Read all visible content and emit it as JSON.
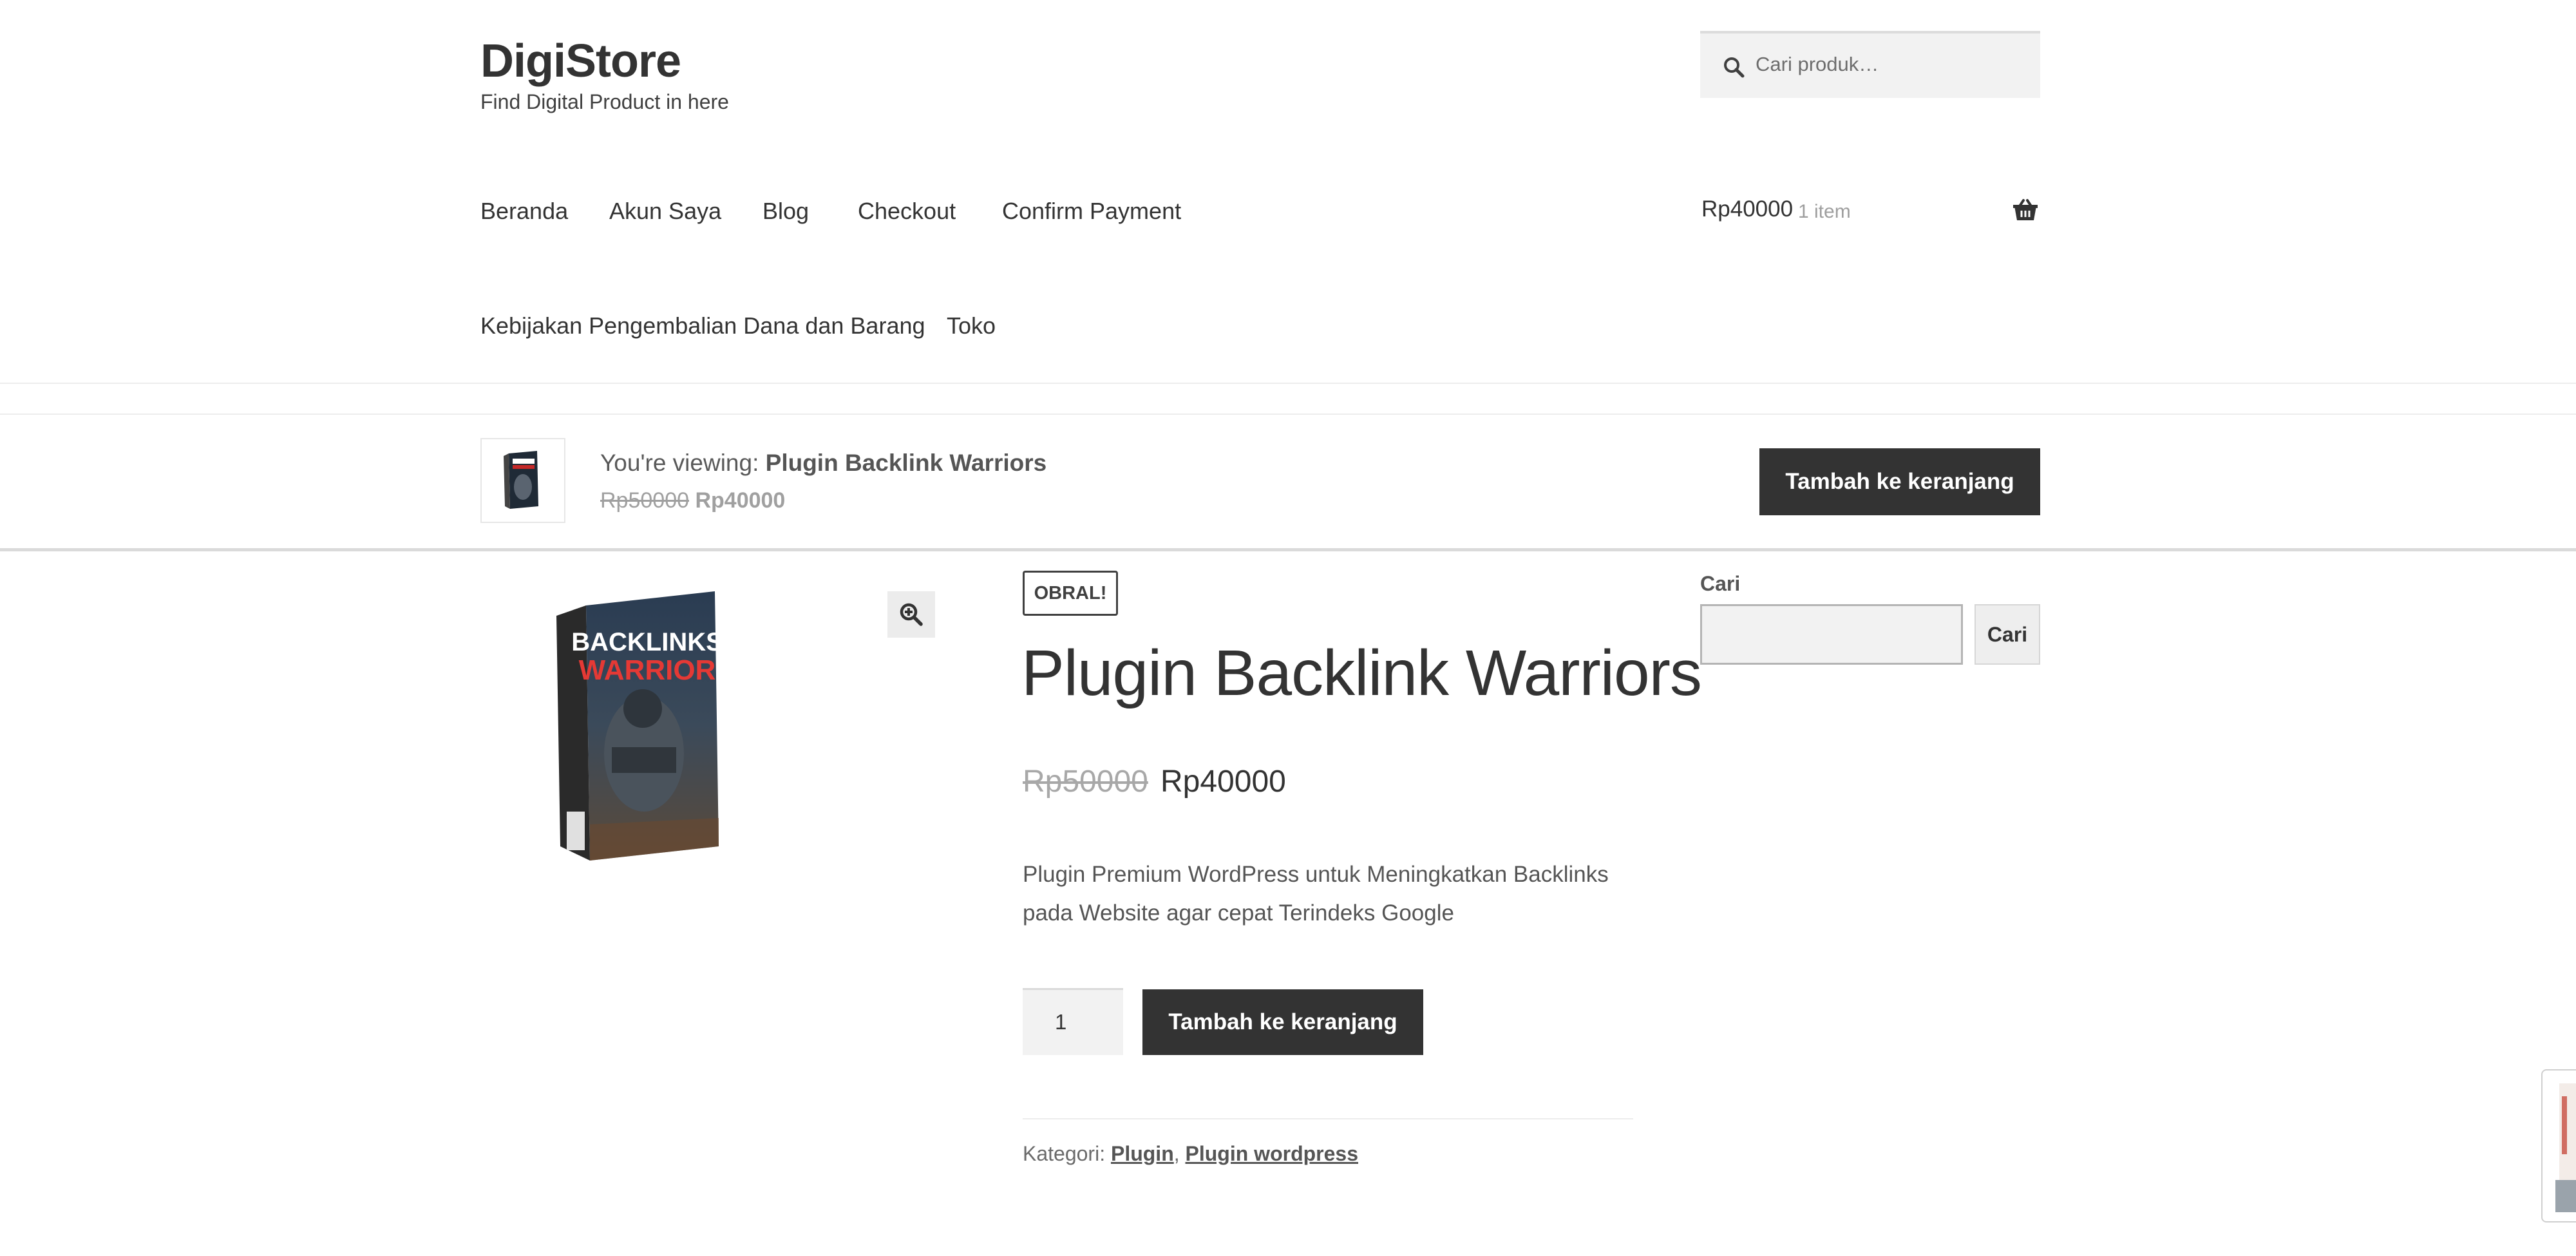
{
  "site": {
    "title": "DigiStore",
    "tagline": "Find Digital Product in here"
  },
  "search": {
    "placeholder": "Cari produk…"
  },
  "nav": {
    "items": [
      {
        "label": "Beranda"
      },
      {
        "label": "Akun Saya"
      },
      {
        "label": "Blog"
      },
      {
        "label": "Checkout"
      },
      {
        "label": "Confirm Payment"
      },
      {
        "label": "Kebijakan Pengembalian Dana dan Barang"
      },
      {
        "label": "Toko"
      }
    ]
  },
  "cart": {
    "total": "Rp40000",
    "count": "1 item"
  },
  "sticky": {
    "viewing_prefix": "You're viewing:",
    "product_name": "Plugin Backlink Warriors",
    "price_old": "Rp50000",
    "price_new": "Rp40000",
    "button_label": "Tambah ke keranjang"
  },
  "product": {
    "badge": "OBRAL!",
    "title": "Plugin Backlink Warriors",
    "price_old": "Rp50000",
    "price_new": "Rp40000",
    "description": "Plugin Premium WordPress untuk Meningkatkan Backlinks pada Website agar cepat Terindeks Google",
    "quantity": "1",
    "add_to_cart_label": "Tambah ke keranjang",
    "box_text_line1": "BACKLINKS",
    "box_text_line2": "WARRIOR",
    "categories_label": "Kategori:",
    "categories": [
      {
        "label": "Plugin"
      },
      {
        "label": "Plugin wordpress"
      }
    ]
  },
  "sidebar": {
    "search_label": "Cari",
    "search_button": "Cari"
  },
  "colors": {
    "primary_dark": "#333333",
    "muted": "#a0a0a0",
    "input_bg": "#f2f2f2"
  }
}
